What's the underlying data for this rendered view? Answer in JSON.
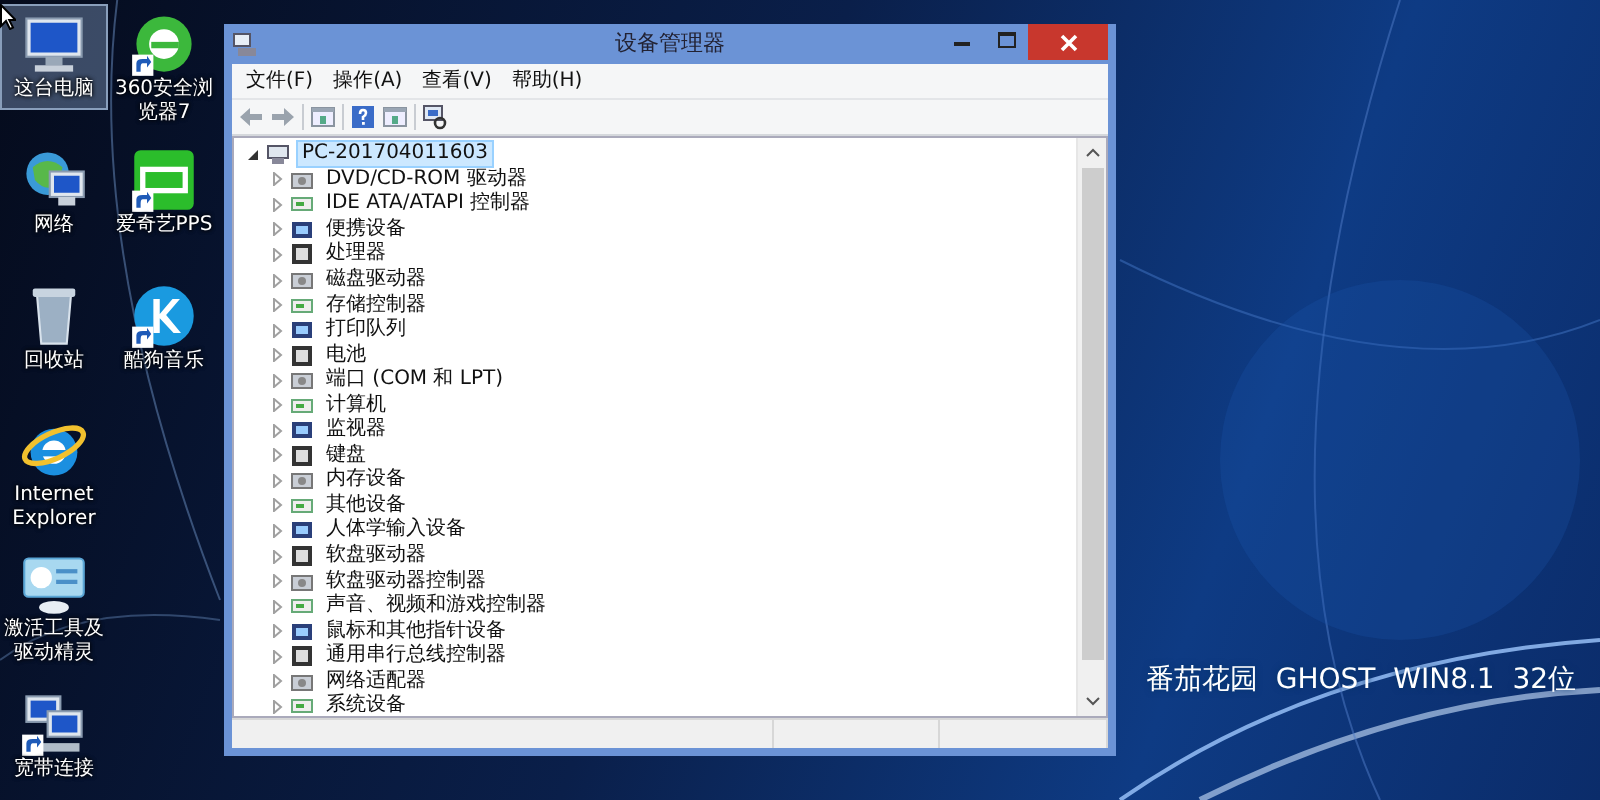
{
  "desktop": {
    "icons": [
      {
        "label": "这台电脑",
        "selected": true
      },
      {
        "label": "360安全浏览器7",
        "selected": false
      },
      {
        "label": "网络",
        "selected": false
      },
      {
        "label": "爱奇艺PPS",
        "selected": false
      },
      {
        "label": "回收站",
        "selected": false
      },
      {
        "label": "酷狗音乐",
        "selected": false
      },
      {
        "label": "Internet Explorer",
        "selected": false
      },
      {
        "label": "激活工具及驱动精灵",
        "selected": false
      },
      {
        "label": "宽带连接",
        "selected": false
      }
    ],
    "wallpaper_text": "番茄花园  GHOST  WIN8.1  32位"
  },
  "window": {
    "title": "设备管理器",
    "menu": [
      "文件(F)",
      "操作(A)",
      "查看(V)",
      "帮助(H)"
    ],
    "tree": {
      "label": "PC-201704011603",
      "expanded": true,
      "selected": true,
      "children": [
        {
          "label": "DVD/CD-ROM 驱动器",
          "expanded": false
        },
        {
          "label": "IDE ATA/ATAPI 控制器",
          "expanded": false
        },
        {
          "label": "便携设备",
          "expanded": false
        },
        {
          "label": "处理器",
          "expanded": false
        },
        {
          "label": "磁盘驱动器",
          "expanded": false
        },
        {
          "label": "存储控制器",
          "expanded": false
        },
        {
          "label": "打印队列",
          "expanded": false
        },
        {
          "label": "电池",
          "expanded": false
        },
        {
          "label": "端口 (COM 和 LPT)",
          "expanded": false
        },
        {
          "label": "计算机",
          "expanded": false
        },
        {
          "label": "监视器",
          "expanded": false
        },
        {
          "label": "键盘",
          "expanded": false
        },
        {
          "label": "内存设备",
          "expanded": false
        },
        {
          "label": "其他设备",
          "expanded": false
        },
        {
          "label": "人体学输入设备",
          "expanded": false
        },
        {
          "label": "软盘驱动器",
          "expanded": false
        },
        {
          "label": "软盘驱动器控制器",
          "expanded": false
        },
        {
          "label": "声音、视频和游戏控制器",
          "expanded": false
        },
        {
          "label": "鼠标和其他指针设备",
          "expanded": false
        },
        {
          "label": "通用串行总线控制器",
          "expanded": false
        },
        {
          "label": "网络适配器",
          "expanded": false
        },
        {
          "label": "系统设备",
          "expanded": false
        }
      ]
    }
  }
}
